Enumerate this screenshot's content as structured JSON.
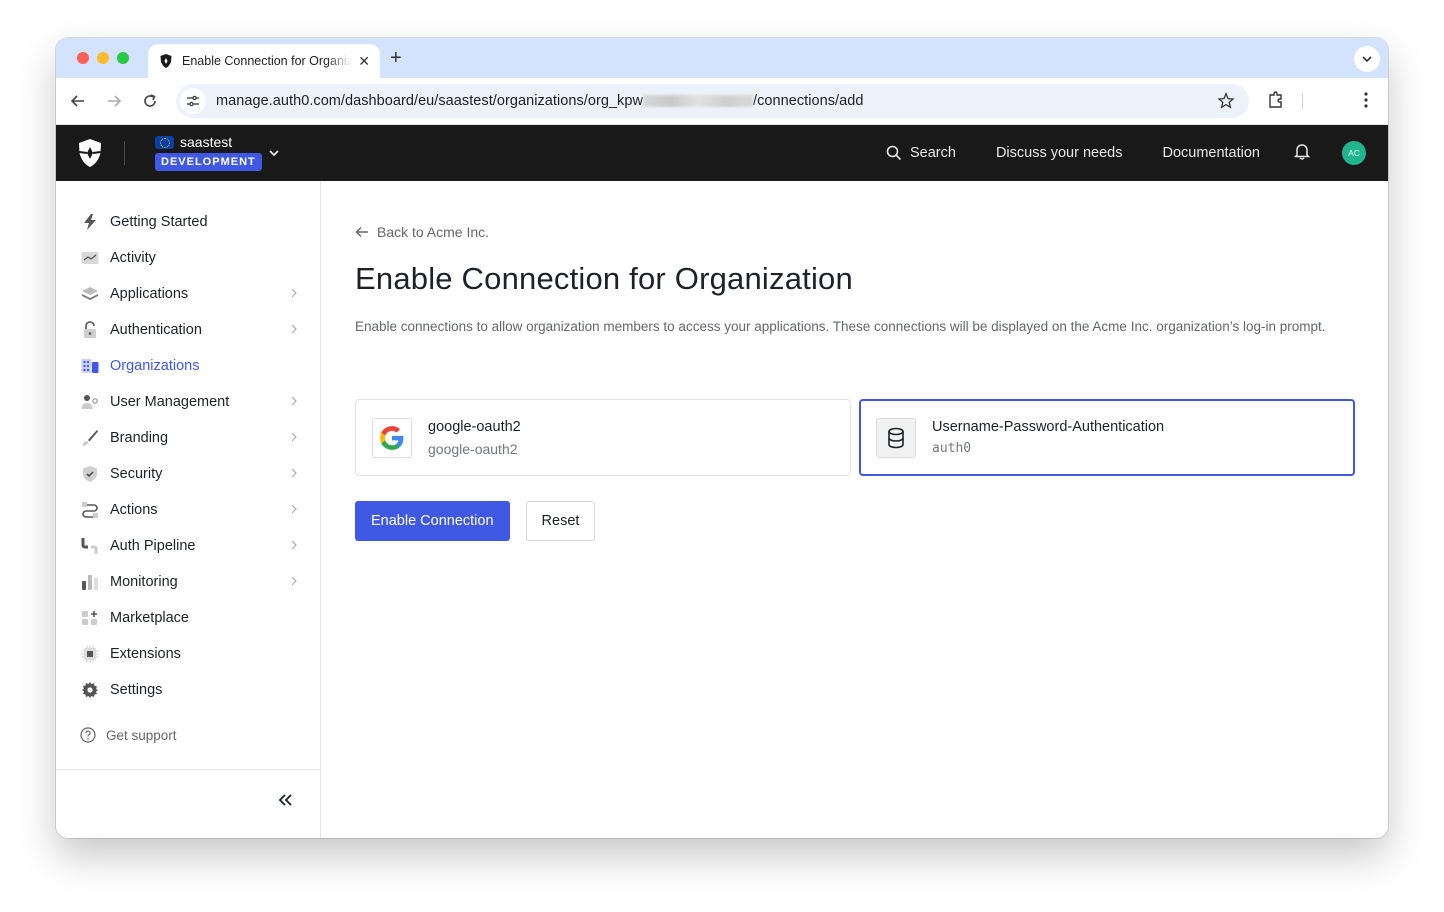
{
  "browser": {
    "tab_title": "Enable Connection for Organization",
    "new_tab_icon": "plus-icon",
    "url_prefix": "manage.auth0.com/dashboard/eu/saastest/organizations/org_kpw",
    "url_suffix": "/connections/add"
  },
  "header": {
    "tenant_name": "saastest",
    "environment": "DEVELOPMENT",
    "search_label": "Search",
    "discuss_label": "Discuss your needs",
    "docs_label": "Documentation",
    "avatar_initials": "AC",
    "avatar_color": "#1fb58f"
  },
  "sidebar": {
    "items": [
      {
        "label": "Getting Started",
        "icon": "lightning-icon",
        "has_chevron": false,
        "active": false
      },
      {
        "label": "Activity",
        "icon": "activity-chart-icon",
        "has_chevron": false,
        "active": false
      },
      {
        "label": "Applications",
        "icon": "layers-icon",
        "has_chevron": true,
        "active": false
      },
      {
        "label": "Authentication",
        "icon": "lock-icon",
        "has_chevron": true,
        "active": false
      },
      {
        "label": "Organizations",
        "icon": "building-icon",
        "has_chevron": false,
        "active": true
      },
      {
        "label": "User Management",
        "icon": "users-icon",
        "has_chevron": true,
        "active": false
      },
      {
        "label": "Branding",
        "icon": "brush-icon",
        "has_chevron": true,
        "active": false
      },
      {
        "label": "Security",
        "icon": "shield-check-icon",
        "has_chevron": true,
        "active": false
      },
      {
        "label": "Actions",
        "icon": "flow-icon",
        "has_chevron": true,
        "active": false
      },
      {
        "label": "Auth Pipeline",
        "icon": "pipeline-icon",
        "has_chevron": true,
        "active": false
      },
      {
        "label": "Monitoring",
        "icon": "bar-chart-icon",
        "has_chevron": true,
        "active": false
      },
      {
        "label": "Marketplace",
        "icon": "grid-plus-icon",
        "has_chevron": false,
        "active": false
      },
      {
        "label": "Extensions",
        "icon": "chip-icon",
        "has_chevron": false,
        "active": false
      },
      {
        "label": "Settings",
        "icon": "gear-icon",
        "has_chevron": false,
        "active": false
      }
    ],
    "support_label": "Get support",
    "accent_color": "#3f59e4"
  },
  "main": {
    "back_label": "Back to Acme Inc.",
    "title": "Enable Connection for Organization",
    "description": "Enable connections to allow organization members to access your applications. These connections will be displayed on the Acme Inc. organization’s log-in prompt.",
    "connections": [
      {
        "name": "google-oauth2",
        "strategy": "google-oauth2",
        "icon": "google-icon",
        "selected": false
      },
      {
        "name": "Username-Password-Authentication",
        "strategy": "auth0",
        "icon": "database-icon",
        "selected": true
      }
    ],
    "primary_button": "Enable Connection",
    "secondary_button": "Reset"
  }
}
